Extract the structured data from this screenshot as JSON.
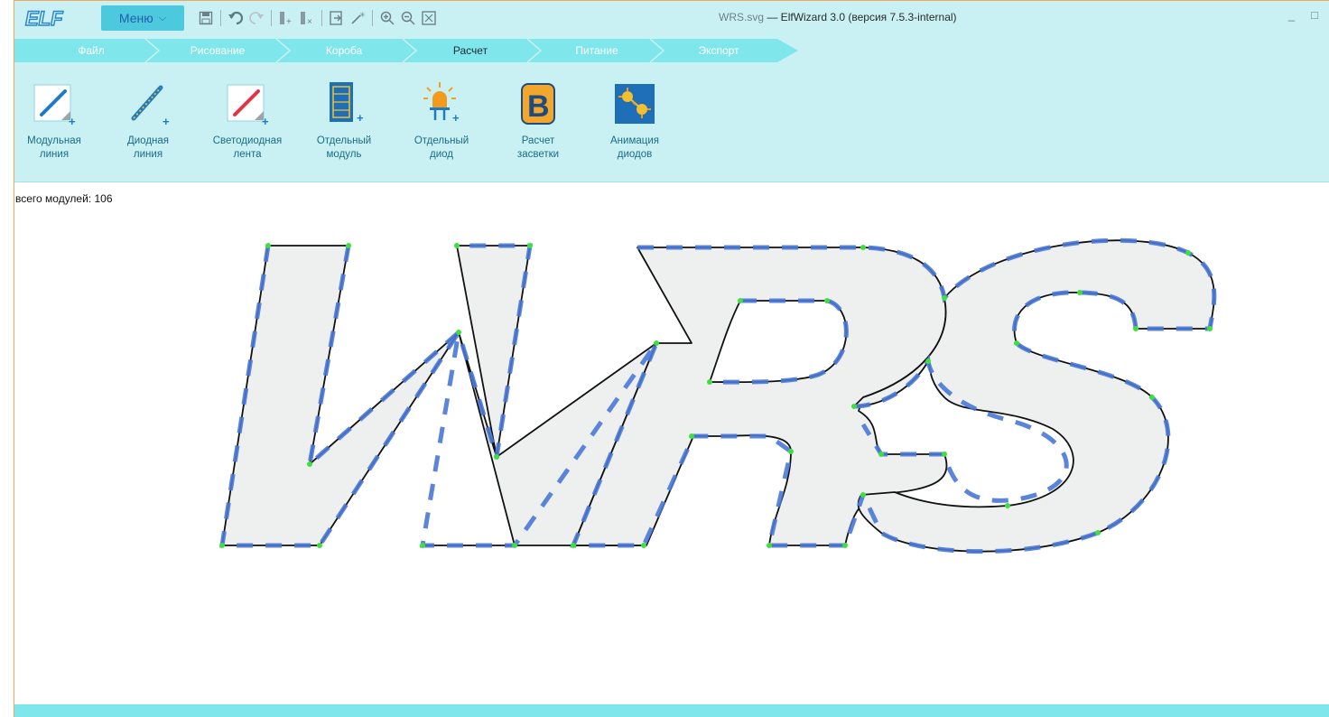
{
  "app": {
    "logo_text": "ELF",
    "menu_label": "Меню",
    "window_title_file": "WRS.svg",
    "window_title_rest": " — ElfWizard 3.0 (версия 7.5.3-internal)",
    "minimize_glyph": "_",
    "maximize_glyph": "□"
  },
  "tabs": [
    {
      "label": "Файл",
      "active": false
    },
    {
      "label": "Рисование",
      "active": false
    },
    {
      "label": "Короба",
      "active": false
    },
    {
      "label": "Расчет",
      "active": true
    },
    {
      "label": "Питание",
      "active": false
    },
    {
      "label": "Экспорт",
      "active": false
    }
  ],
  "tools": [
    {
      "line1": "Модульная",
      "line2": "линия",
      "icon": "modular-line-icon"
    },
    {
      "line1": "Диодная",
      "line2": "линия",
      "icon": "diode-line-icon"
    },
    {
      "line1": "Светодиодная",
      "line2": "лента",
      "icon": "led-strip-icon"
    },
    {
      "line1": "Отдельный",
      "line2": "модуль",
      "icon": "single-module-icon"
    },
    {
      "line1": "Отдельный",
      "line2": "диод",
      "icon": "single-diode-icon"
    },
    {
      "line1": "Расчет",
      "line2": "засветки",
      "icon": "illumination-calc-icon"
    },
    {
      "line1": "Анимация",
      "line2": "диодов",
      "icon": "diode-animation-icon"
    }
  ],
  "canvas": {
    "module_count_text": "всего модулей: 106"
  },
  "colors": {
    "ribbon_bg": "#c9f1f3",
    "tab_bg": "#7fe6ec",
    "accent_blue": "#4a78d8",
    "node_green": "#3ee03e",
    "outline": "#111111"
  }
}
